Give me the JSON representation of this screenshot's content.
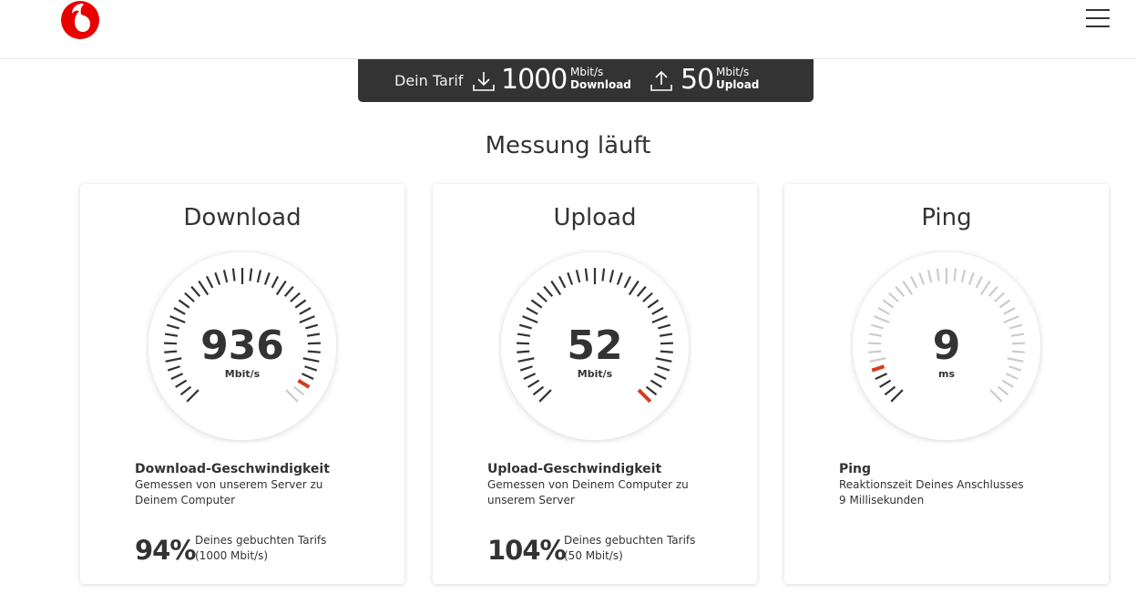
{
  "header": {
    "logo": "vodafone-logo",
    "menu_icon": "hamburger-menu-icon"
  },
  "tarif": {
    "label": "Dein Tarif",
    "download_value": "1000",
    "download_unit": "Mbit/s",
    "download_label": "Download",
    "upload_value": "50",
    "upload_unit": "Mbit/s",
    "upload_label": "Upload"
  },
  "heading": "Messung läuft",
  "cards": [
    {
      "title": "Download",
      "value": "936",
      "unit": "Mbit/s",
      "gauge_fraction": 0.94,
      "desc_head": "Download-Geschwindigkeit",
      "desc_line1": "Gemessen von unserem Server zu",
      "desc_line2": "Deinem Computer",
      "pct": "94%",
      "pct_note1": "Deines gebuchten Tarifs",
      "pct_note2": "(1000 Mbit/s)"
    },
    {
      "title": "Upload",
      "value": "52",
      "unit": "Mbit/s",
      "gauge_fraction": 1.0,
      "desc_head": "Upload-Geschwindigkeit",
      "desc_line1": "Gemessen von Deinem Computer zu",
      "desc_line2": "unserem Server",
      "pct": "104%",
      "pct_note1": "Deines gebuchten Tarifs",
      "pct_note2": "(50 Mbit/s)"
    },
    {
      "title": "Ping",
      "value": "9",
      "unit": "ms",
      "gauge_fraction": 0.09,
      "desc_head": "Ping",
      "desc_line1": "Reaktionszeit Deines Anschlusses",
      "desc_line2": "9 Millisekunden"
    }
  ],
  "colors": {
    "accent": "#e60000",
    "marker": "#d83a1f",
    "dark": "#333333",
    "tick_active": "#333333",
    "tick_inactive": "#cccccc"
  }
}
